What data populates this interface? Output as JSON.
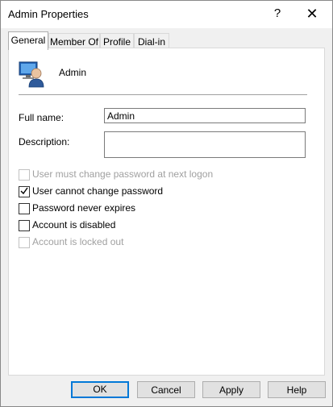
{
  "window": {
    "title": "Admin Properties",
    "help_glyph": "?",
    "close_glyph": "✕"
  },
  "tabs": [
    {
      "label": "General",
      "active": true
    },
    {
      "label": "Member Of",
      "active": false
    },
    {
      "label": "Profile",
      "active": false
    },
    {
      "label": "Dial-in",
      "active": false
    }
  ],
  "user": {
    "name": "Admin",
    "icon": "user-account-icon"
  },
  "fields": {
    "full_name": {
      "label": "Full name:",
      "value": "Admin"
    },
    "description": {
      "label": "Description:",
      "value": ""
    }
  },
  "checkboxes": [
    {
      "label": "User must change password at next logon",
      "checked": false,
      "enabled": false
    },
    {
      "label": "User cannot change password",
      "checked": true,
      "enabled": true
    },
    {
      "label": "Password never expires",
      "checked": false,
      "enabled": true
    },
    {
      "label": "Account is disabled",
      "checked": false,
      "enabled": true
    },
    {
      "label": "Account is locked out",
      "checked": false,
      "enabled": false
    }
  ],
  "buttons": {
    "ok": "OK",
    "cancel": "Cancel",
    "apply": "Apply",
    "help": "Help"
  },
  "colors": {
    "accent": "#0078d7",
    "dialog_bg": "#f0f0f0"
  }
}
